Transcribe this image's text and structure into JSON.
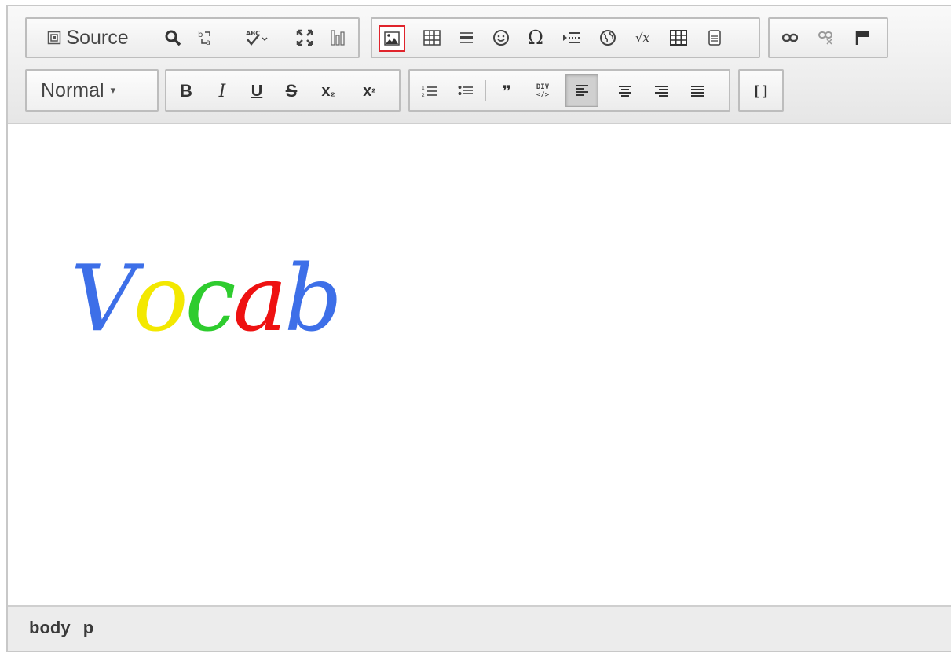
{
  "toolbar": {
    "source_label": "Source",
    "format_label": "Normal",
    "format_arrow": "▾",
    "bold": "B",
    "italic": "I",
    "underline": "U",
    "strike": "S",
    "subscript_base": "x",
    "subscript_mark": "₂",
    "superscript_base": "x",
    "superscript_mark": "²",
    "blockquote": "❞",
    "omega": "Ω",
    "sqrt": "√x",
    "brackets": "[]",
    "div_label_top": "DIV",
    "div_label_bottom": "</>",
    "spell_label": "ABC",
    "active_button": "align-left"
  },
  "content": {
    "vocab_letters": [
      {
        "char": "V",
        "color": "#3d6fe8"
      },
      {
        "char": "o",
        "color": "#f3e800"
      },
      {
        "char": "c",
        "color": "#2ecc2e"
      },
      {
        "char": "a",
        "color": "#ee1111"
      },
      {
        "char": "b",
        "color": "#3d6fe8"
      }
    ]
  },
  "status": {
    "path": [
      "body",
      "p"
    ]
  },
  "colors": {
    "image_button_border": "#e0242c",
    "toolbar_bg": "#ececec"
  }
}
